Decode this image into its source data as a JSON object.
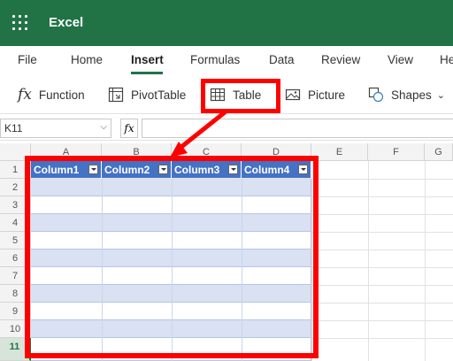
{
  "app": {
    "title": "Excel"
  },
  "tabs": [
    "File",
    "Home",
    "Insert",
    "Formulas",
    "Data",
    "Review",
    "View",
    "He"
  ],
  "active_tab": "Insert",
  "ribbon": {
    "function": "Function",
    "pivottable": "PivotTable",
    "table": "Table",
    "picture": "Picture",
    "shapes": "Shapes"
  },
  "formula_bar": {
    "name_box": "K11",
    "fx": "fx",
    "formula": ""
  },
  "columns": [
    "A",
    "B",
    "C",
    "D",
    "E",
    "F",
    "G"
  ],
  "rows": [
    "1",
    "2",
    "3",
    "4",
    "5",
    "6",
    "7",
    "8",
    "9",
    "10",
    "11"
  ],
  "selected_row": "11",
  "table": {
    "headers": [
      "Column1",
      "Column2",
      "Column3",
      "Column4"
    ]
  },
  "colors": {
    "brand": "#217346",
    "table_header": "#4472c4",
    "table_band": "#d9e1f2",
    "annotation": "#ff0000"
  }
}
